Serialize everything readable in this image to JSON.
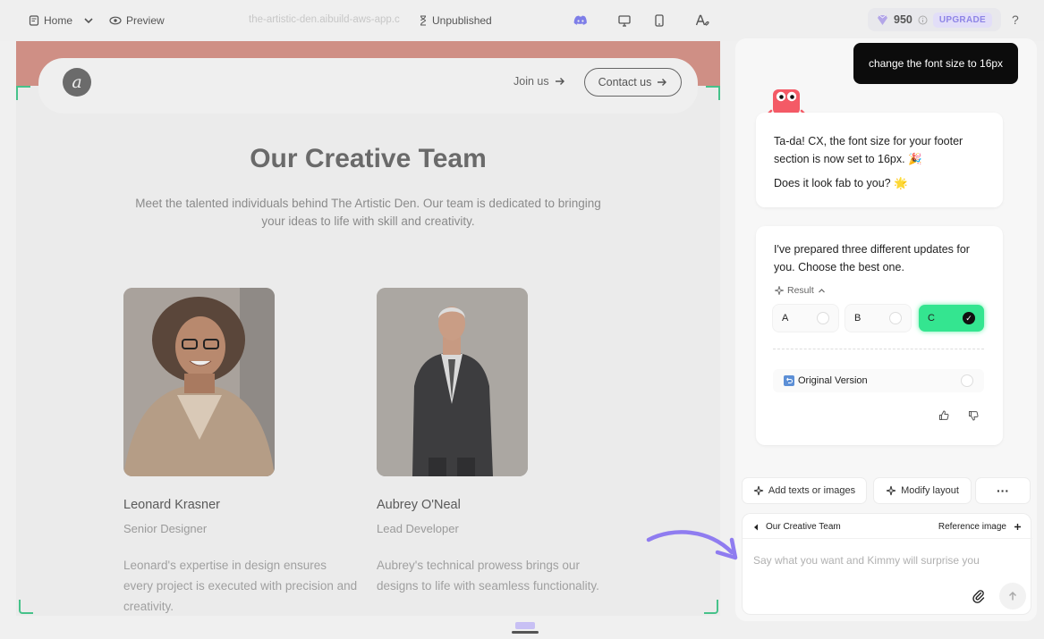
{
  "topbar": {
    "home_label": "Home",
    "preview_label": "Preview",
    "url": "the-artistic-den.aibuild-aws-app.c",
    "status": "Unpublished",
    "credits": "950",
    "upgrade_label": "UPGRADE",
    "help_label": "?"
  },
  "site": {
    "logo_letter": "a",
    "join_label": "Join us",
    "contact_label": "Contact us",
    "section_title": "Our Creative Team",
    "section_subtitle": "Meet the talented individuals behind The Artistic Den. Our team is dedicated to bringing your ideas to life with skill and creativity.",
    "members": [
      {
        "name": "Leonard Krasner",
        "role": "Senior Designer",
        "bio": "Leonard's expertise in design ensures every project is executed with precision and creativity."
      },
      {
        "name": "Aubrey O'Neal",
        "role": "Lead Developer",
        "bio": "Aubrey's technical prowess brings our designs to life with seamless functionality."
      }
    ]
  },
  "chat": {
    "user_message": "change the font size to 16px",
    "reply_line1": "Ta-da! CX, the font size for your footer section is now set to 16px. 🎉",
    "reply_line2": "Does it look fab to you? 🌟",
    "options_intro": "I've prepared three different updates for you. Choose the best one.",
    "result_label": "Result",
    "options": [
      "A",
      "B",
      "C"
    ],
    "selected_option": "C",
    "original_label": "Original Version"
  },
  "actions": {
    "add_label": "Add texts or images",
    "modify_label": "Modify layout",
    "more_label": "···"
  },
  "composer": {
    "context_label": "Our Creative Team",
    "reference_label": "Reference image",
    "placeholder": "Say what you want and Kimmy will surprise you"
  },
  "colors": {
    "accent_green": "#34e590",
    "hero_strip": "#cf8f85",
    "selection_corner": "#46c28a",
    "upgrade_text": "#8e85e6",
    "arrow_purple": "#8f7cf0",
    "mascot_red": "#f45a66"
  },
  "icons": {
    "home": "page-icon",
    "preview": "eye-icon",
    "status": "hourglass-icon",
    "discord": "discord-icon",
    "desktop": "desktop-icon",
    "mobile": "mobile-icon",
    "font": "font-style-icon",
    "credits": "gem-icon",
    "send": "arrow-up-icon",
    "attach": "paperclip-icon"
  }
}
